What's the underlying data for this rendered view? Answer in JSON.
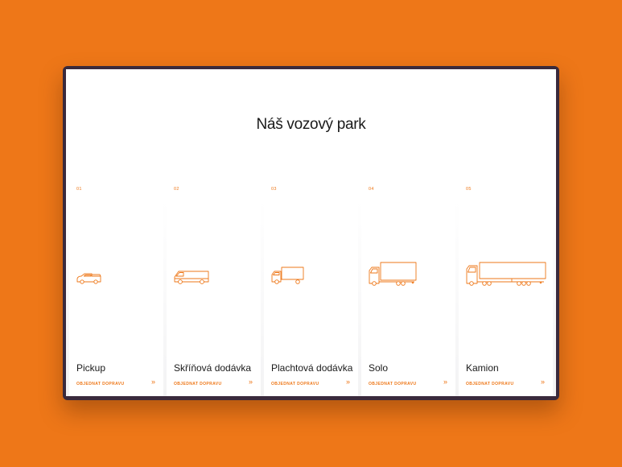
{
  "page": {
    "heading": "Náš vozový park"
  },
  "vehicles": [
    {
      "number": "01",
      "title": "Pickup",
      "cta": "OBJEDNAT DOPRAVU",
      "icon": "pickup-car-icon"
    },
    {
      "number": "02",
      "title": "Skříňová dodávka",
      "cta": "OBJEDNAT DOPRAVU",
      "icon": "box-van-icon"
    },
    {
      "number": "03",
      "title": "Plachtová dodávka",
      "cta": "OBJEDNAT DOPRAVU",
      "icon": "tarp-van-icon"
    },
    {
      "number": "04",
      "title": "Solo",
      "cta": "OBJEDNAT DOPRAVU",
      "icon": "solo-truck-icon"
    },
    {
      "number": "05",
      "title": "Kamion",
      "cta": "OBJEDNAT DOPRAVU",
      "icon": "semi-truck-icon"
    }
  ],
  "colors": {
    "accent": "#EE7718",
    "background": "#EE7718",
    "frame": "#3a2a3c"
  }
}
